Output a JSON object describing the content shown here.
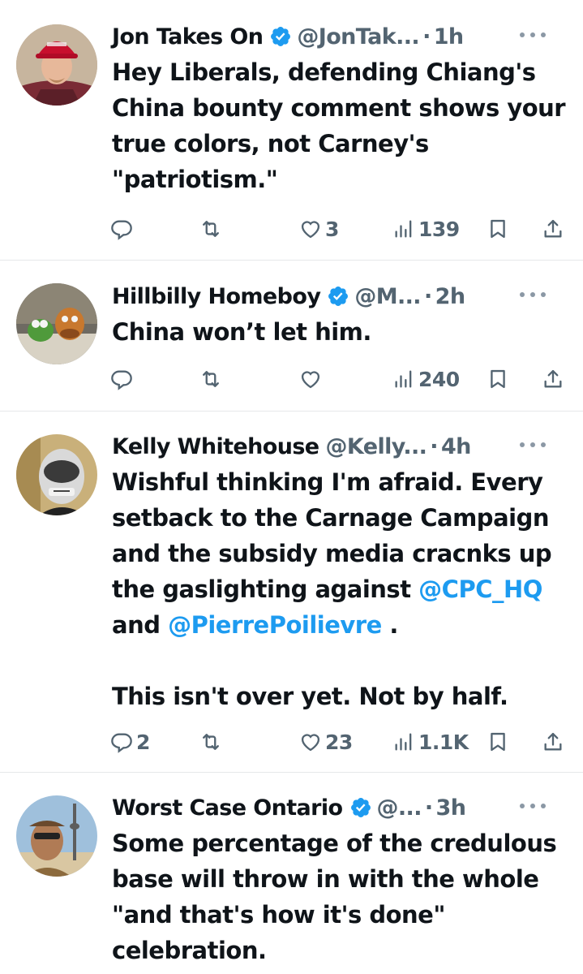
{
  "replies": [
    {
      "name": "Jon Takes On",
      "verified": true,
      "handle": "@JonTak...",
      "time": "1h",
      "text": "Hey Liberals, defending Chiang's China bounty comment shows your true colors, not Carney's \"patriotism.\"",
      "stats": {
        "replies": "",
        "reposts": "",
        "likes": "3",
        "views": "139"
      }
    },
    {
      "name": "Hillbilly Homeboy",
      "verified": true,
      "handle": "@M...",
      "time": "2h",
      "text": "China won’t let him.",
      "stats": {
        "replies": "",
        "reposts": "",
        "likes": "",
        "views": "240"
      }
    },
    {
      "name": "Kelly Whitehouse",
      "verified": false,
      "handle": "@Kelly...",
      "time": "4h",
      "text_parts": {
        "a": "Wishful thinking I'm afraid. Every setback to the Carnage Campaign and the subsidy media cracnks up the gaslighting against ",
        "mention1": "@CPC_HQ",
        "b": " and ",
        "mention2": "@PierrePoilievre",
        "c": " .",
        "d": "This isn't over yet. Not by half."
      },
      "stats": {
        "replies": "2",
        "reposts": "",
        "likes": "23",
        "views": "1.1K"
      }
    },
    {
      "name": "Worst Case Ontario",
      "verified": true,
      "handle": "@...",
      "time": "3h",
      "text": "Some percentage of the credulous base will throw in with the whole \"and that's how it's done\" celebration."
    }
  ],
  "separator": "·",
  "colors": {
    "text": "#0f1419",
    "secondary": "#536471",
    "accent": "#1d9bf0",
    "divider": "#e6e8ea"
  },
  "icons": [
    "reply-icon",
    "repost-icon",
    "like-icon",
    "views-icon",
    "bookmark-icon",
    "share-icon",
    "verified-badge-icon",
    "more-options-icon"
  ]
}
